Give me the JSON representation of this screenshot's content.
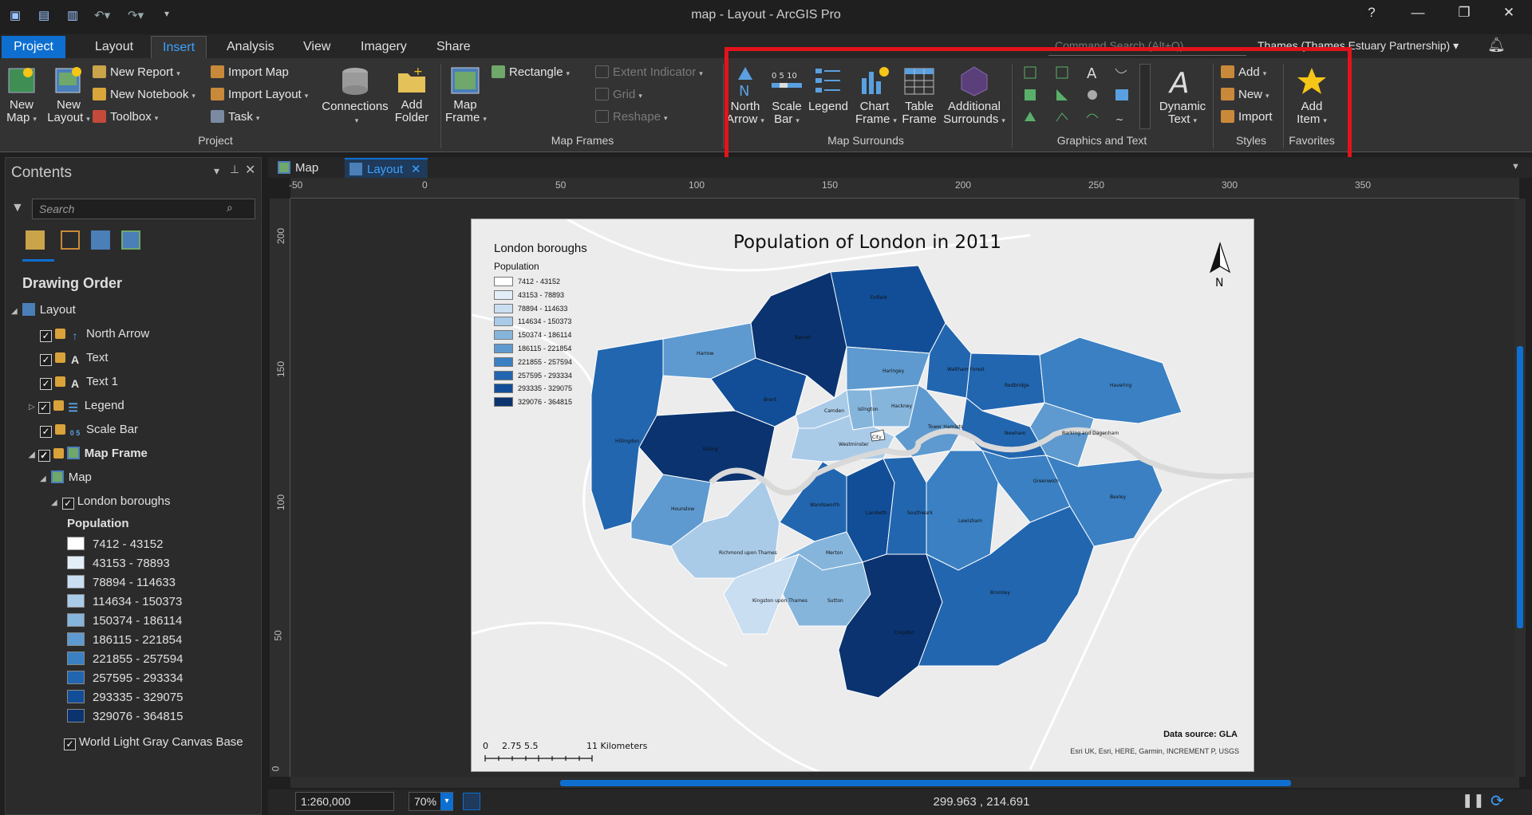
{
  "window": {
    "title": "map - Layout - ArcGIS Pro",
    "help": "?",
    "minimize": "—",
    "restore": "❐",
    "close": "✕"
  },
  "tabs": [
    {
      "label": "Project"
    },
    {
      "label": "Layout"
    },
    {
      "label": "Insert"
    },
    {
      "label": "Analysis"
    },
    {
      "label": "View"
    },
    {
      "label": "Imagery"
    },
    {
      "label": "Share"
    }
  ],
  "command_search": {
    "placeholder": "Command Search (Alt+Q)"
  },
  "account": {
    "label": "Thames (Thames Estuary Partnership) ▾"
  },
  "ribbon": {
    "project": {
      "new_map": "New Map",
      "new_layout": "New Layout",
      "new_report": "New Report",
      "new_notebook": "New Notebook",
      "toolbox": "Toolbox",
      "import_map": "Import Map",
      "import_layout": "Import Layout",
      "task": "Task",
      "connections": "Connections",
      "add_folder": "Add Folder",
      "group": "Project"
    },
    "map_frames": {
      "map_frame": "Map Frame",
      "rectangle": "Rectangle",
      "extent_indicator": "Extent Indicator",
      "grid": "Grid",
      "reshape": "Reshape",
      "group": "Map Frames"
    },
    "map_surrounds": {
      "north_arrow": "North Arrow",
      "scale_bar": "Scale Bar",
      "legend": "Legend",
      "chart_frame": "Chart Frame",
      "table_frame": "Table Frame",
      "additional_surrounds": "Additional Surrounds",
      "group": "Map Surrounds"
    },
    "graphics_text": {
      "dynamic_text": "Dynamic Text",
      "group": "Graphics and Text"
    },
    "styles": {
      "add": "Add",
      "new": "New",
      "import": "Import",
      "group": "Styles"
    },
    "favorites": {
      "add_item": "Add Item",
      "group": "Favorites"
    }
  },
  "contents": {
    "title": "Contents",
    "search_placeholder": "Search",
    "drawing_order": "Drawing Order",
    "tree": {
      "layout": "Layout",
      "north_arrow": "North Arrow",
      "text": "Text",
      "text1": "Text 1",
      "legend": "Legend",
      "scale_bar": "Scale Bar",
      "map_frame": "Map Frame",
      "map": "Map",
      "london_boroughs": "London boroughs",
      "population": "Population",
      "basemap": "World Light Gray Canvas Base"
    }
  },
  "classes": [
    {
      "label": "7412 - 43152",
      "color": "#ffffff"
    },
    {
      "label": "43153 - 78893",
      "color": "#e4eef9"
    },
    {
      "label": "78894 - 114633",
      "color": "#cadef2"
    },
    {
      "label": "114634 - 150373",
      "color": "#aacbe8"
    },
    {
      "label": "150374 - 186114",
      "color": "#86b5dc"
    },
    {
      "label": "186115 - 221854",
      "color": "#5e9acf"
    },
    {
      "label": "221855 - 257594",
      "color": "#3a80c3"
    },
    {
      "label": "257595 - 293334",
      "color": "#2266b0"
    },
    {
      "label": "293335 - 329075",
      "color": "#124e97"
    },
    {
      "label": "329076 - 364815",
      "color": "#0a3370"
    }
  ],
  "doc_tabs": {
    "map": "Map",
    "layout": "Layout"
  },
  "ruler": {
    "h_ticks": [
      "-50",
      "0",
      "50",
      "100",
      "150",
      "200",
      "250",
      "300",
      "350"
    ],
    "v_ticks": [
      "200",
      "150",
      "100",
      "50",
      "0"
    ]
  },
  "layout_page": {
    "title": "Population of London in 2011",
    "legend_title": "London boroughs",
    "legend_field": "Population",
    "north_label": "N",
    "data_source": "Data source: GLA",
    "credits": "Esri UK, Esri, HERE, Garmin, INCREMENT P, USGS",
    "scalebar": {
      "ticks": [
        "0",
        "2.75",
        "5.5",
        "11 Kilometers"
      ]
    },
    "borough_labels": {
      "enfield": "Enfield",
      "barnet": "Barnet",
      "harrow": "Harrow",
      "haringey": "Haringey",
      "waltham_forest": "Waltham Forest",
      "redbridge": "Redbridge",
      "havering": "Havering",
      "hillingdon": "Hillingdon",
      "brent": "Brent",
      "camden": "Camden",
      "islington": "Islington",
      "hackney": "Hackney",
      "barking": "Barking and Dagenham",
      "ealing": "Ealing",
      "westminster": "Westminster",
      "tower_hamlets": "Tower Hamlets",
      "newham": "Newham",
      "city": "City",
      "hounslow": "Hounslow",
      "richmond": "Richmond upon Thames",
      "wandsworth": "Wandsworth",
      "lambeth": "Lambeth",
      "southwark": "Southwark",
      "lewisham": "Lewisham",
      "greenwich": "Greenwich",
      "bexley": "Bexley",
      "kingston": "Kingston upon Thames",
      "merton": "Merton",
      "sutton": "Sutton",
      "croydon": "Croydon",
      "bromley": "Bromley"
    }
  },
  "status": {
    "scale": "1:260,000",
    "zoom": "70%",
    "coordinates": "299.963 , 214.691"
  }
}
